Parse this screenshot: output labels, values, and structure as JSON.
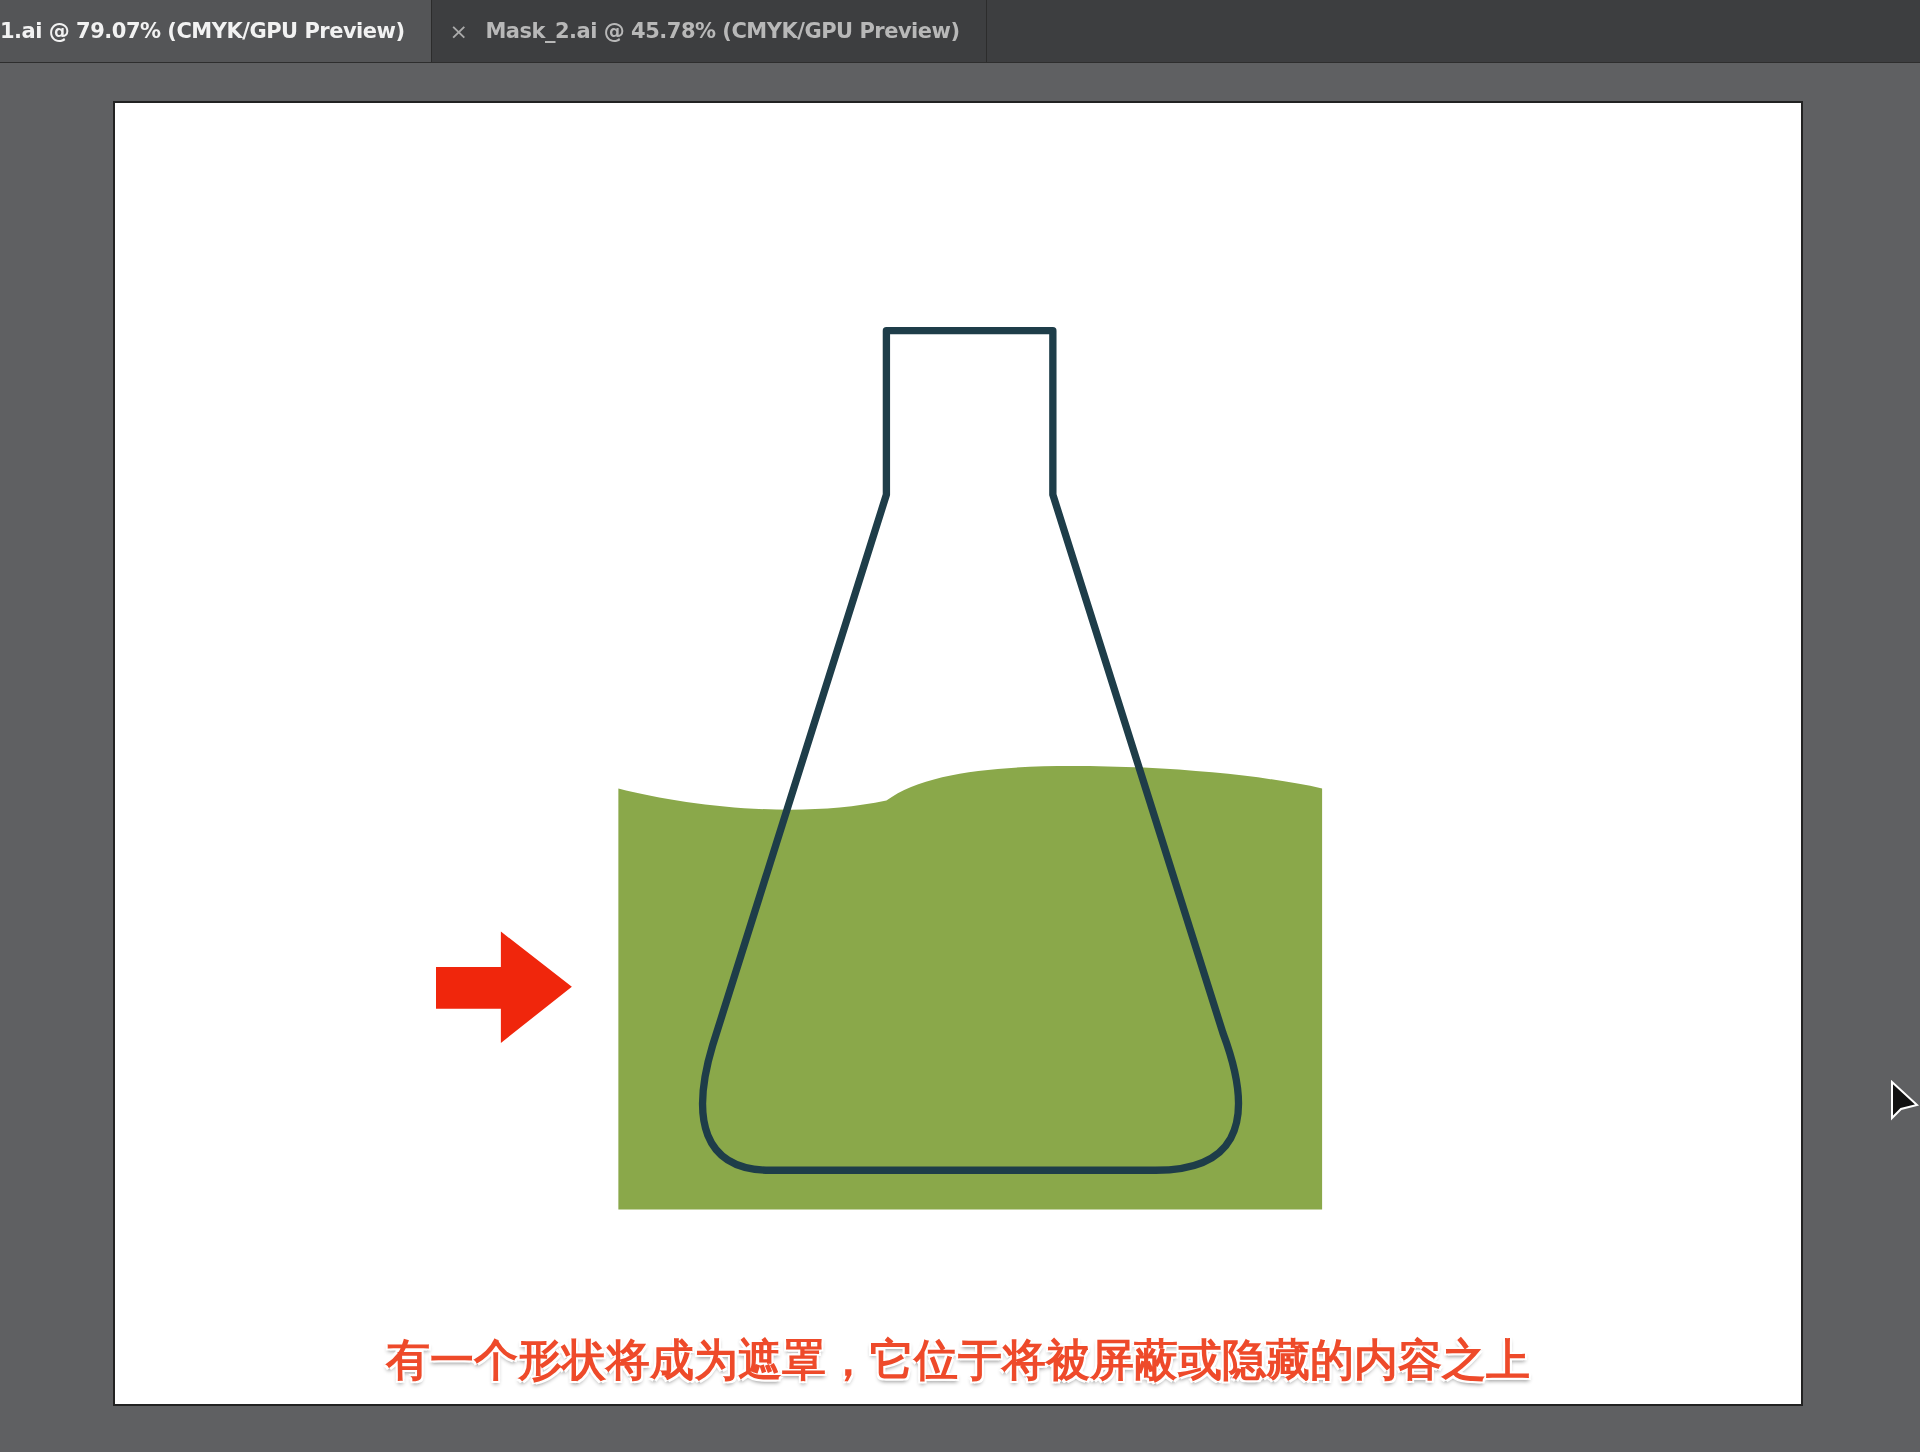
{
  "tabs": [
    {
      "label": "1.ai @ 79.07% (CMYK/GPU Preview)",
      "selected": true
    },
    {
      "label": "Mask_2.ai @ 45.78% (CMYK/GPU Preview)",
      "selected": false,
      "close": "×"
    }
  ],
  "subtitle": "有一个形状将成为遮罩，它位于将被屏蔽或隐藏的内容之上"
}
